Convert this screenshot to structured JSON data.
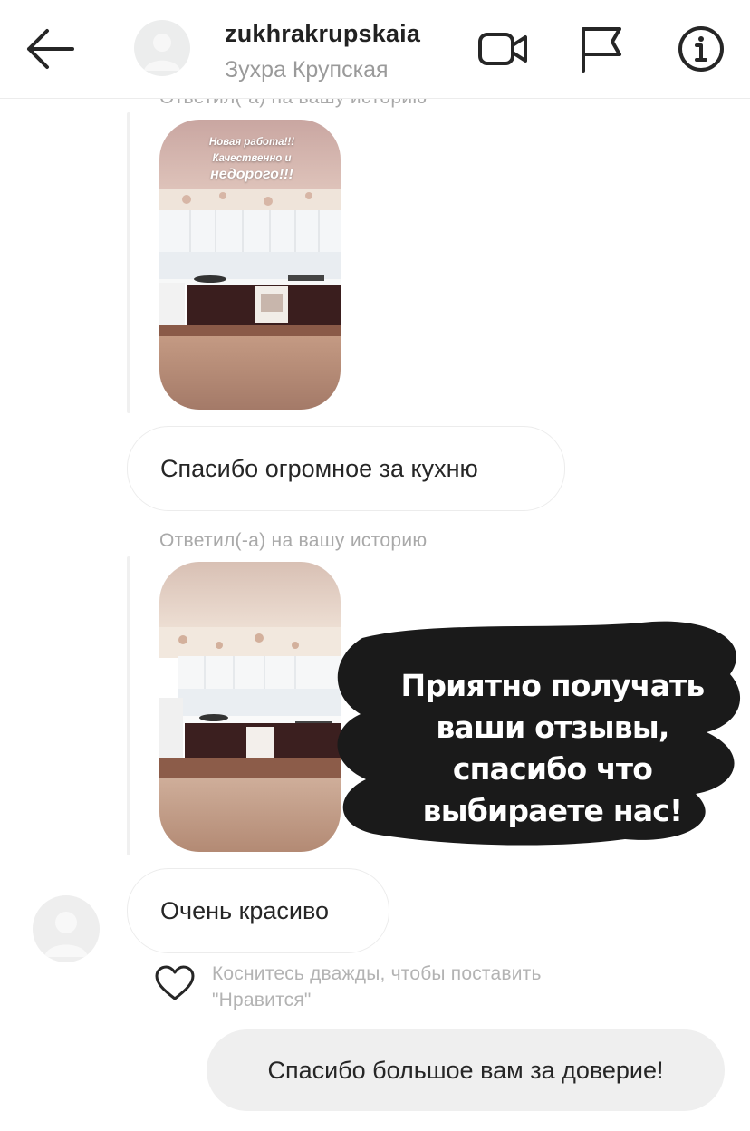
{
  "header": {
    "username": "zukhrakrupskaia",
    "full_name": "Зухра Крупская",
    "icons": [
      "back-arrow-icon",
      "video-camera-icon",
      "flag-icon",
      "info-icon"
    ]
  },
  "messages": {
    "reply_label_1": "Ответил(-а) на вашу историю",
    "story_1_caption_line1": "Новая работа!!!",
    "story_1_caption_line2": "Качественно и",
    "story_1_caption_line3": "недорого!!!",
    "bubble_1": "Спасибо огромное за кухню",
    "reply_label_2": "Ответил(-а) на вашу историю",
    "overlay_text": "Приятно получать ваши отзывы, спасибо что выбираете нас!",
    "bubble_2": "Очень красиво",
    "like_hint_line1": "Коснитесь дважды, чтобы поставить",
    "like_hint_line2": "\"Нравится\"",
    "bubble_mine": "Спасибо большое вам за доверие!"
  },
  "colors": {
    "meta_text": "#a9a9a9",
    "bubble_border": "#ececec",
    "my_bubble_bg": "#efefef",
    "overlay": "#1a1a1a"
  }
}
